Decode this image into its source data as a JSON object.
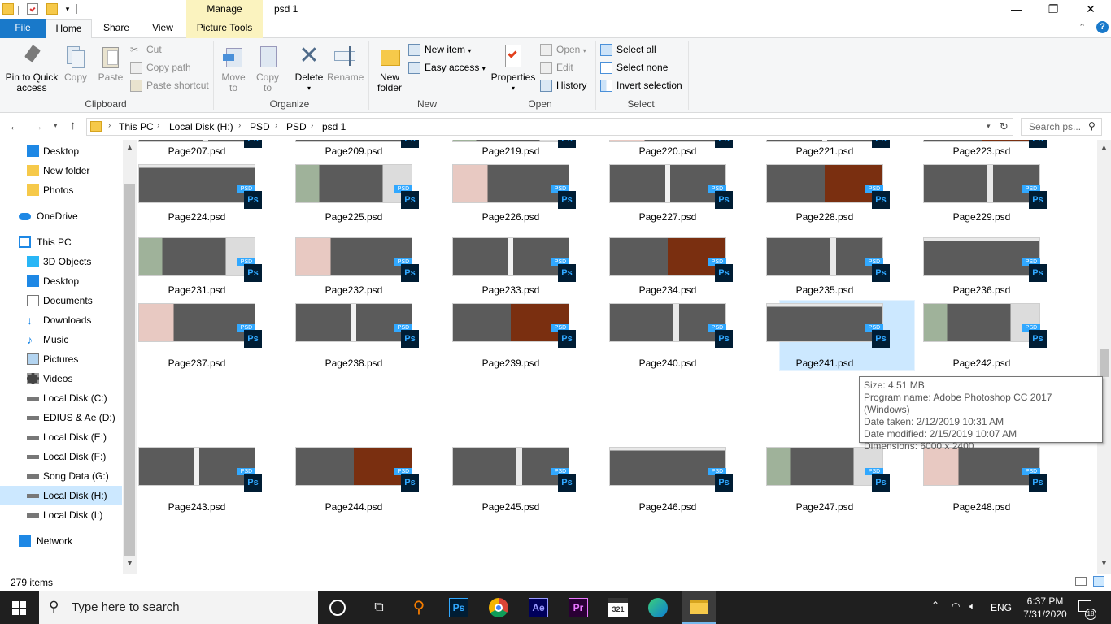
{
  "window": {
    "title": "psd 1",
    "contextual_tab": "Manage",
    "controls": {
      "minimize": "—",
      "restore": "❐",
      "close": "✕"
    }
  },
  "tabs": {
    "file": "File",
    "home": "Home",
    "share": "Share",
    "view": "View",
    "picture_tools": "Picture Tools"
  },
  "ribbon": {
    "clipboard": {
      "label": "Clipboard",
      "pin_line1": "Pin to Quick",
      "pin_line2": "access",
      "copy": "Copy",
      "paste": "Paste",
      "cut": "Cut",
      "copy_path": "Copy path",
      "paste_shortcut": "Paste shortcut"
    },
    "organize": {
      "label": "Organize",
      "move_line1": "Move",
      "move_line2": "to",
      "copy_line1": "Copy",
      "copy_line2": "to",
      "delete": "Delete",
      "rename": "Rename"
    },
    "new": {
      "label": "New",
      "folder_line1": "New",
      "folder_line2": "folder",
      "new_item": "New item",
      "easy_access": "Easy access"
    },
    "open": {
      "label": "Open",
      "properties": "Properties",
      "open": "Open",
      "edit": "Edit",
      "history": "History"
    },
    "select": {
      "label": "Select",
      "select_all": "Select all",
      "select_none": "Select none",
      "invert": "Invert selection"
    }
  },
  "address": {
    "crumbs": [
      "This PC",
      "Local Disk (H:)",
      "PSD",
      "PSD",
      "psd 1"
    ],
    "search_placeholder": "Search ps..."
  },
  "nav": [
    {
      "label": "Desktop",
      "icon": "desktop-icon"
    },
    {
      "label": "New folder",
      "icon": "folder-icon"
    },
    {
      "label": "Photos",
      "icon": "folder-icon"
    },
    {
      "label": "OneDrive",
      "icon": "cloud-icon"
    },
    {
      "label": "This PC",
      "icon": "pc-icon"
    },
    {
      "label": "3D Objects",
      "icon": "cube-icon"
    },
    {
      "label": "Desktop",
      "icon": "desktop-icon"
    },
    {
      "label": "Documents",
      "icon": "documents-icon"
    },
    {
      "label": "Downloads",
      "icon": "download-icon"
    },
    {
      "label": "Music",
      "icon": "music-icon"
    },
    {
      "label": "Pictures",
      "icon": "pictures-icon"
    },
    {
      "label": "Videos",
      "icon": "videos-icon"
    },
    {
      "label": "Local Disk (C:)",
      "icon": "drive-icon"
    },
    {
      "label": "EDIUS & Ae (D:)",
      "icon": "drive-icon"
    },
    {
      "label": "Local Disk (E:)",
      "icon": "drive-icon"
    },
    {
      "label": "Local Disk (F:)",
      "icon": "drive-icon"
    },
    {
      "label": "Song Data (G:)",
      "icon": "drive-icon"
    },
    {
      "label": "Local Disk (H:)",
      "icon": "drive-icon",
      "selected": true
    },
    {
      "label": "Local Disk (I:)",
      "icon": "drive-icon"
    },
    {
      "label": "Network",
      "icon": "network-icon"
    }
  ],
  "files": {
    "row0": [
      "Page207.psd",
      "Page209.psd",
      "Page219.psd",
      "Page220.psd",
      "Page221.psd",
      "Page223.psd"
    ],
    "row1": [
      "Page224.psd",
      "Page225.psd",
      "Page226.psd",
      "Page227.psd",
      "Page228.psd",
      "Page229.psd"
    ],
    "row2": [
      "Page231.psd",
      "Page232.psd",
      "Page233.psd",
      "Page234.psd",
      "Page235.psd",
      "Page236.psd"
    ],
    "row3": [
      "Page237.psd",
      "Page238.psd",
      "Page239.psd",
      "Page240.psd",
      "Page241.psd",
      "Page242.psd"
    ],
    "row4": [
      "Page243.psd",
      "Page244.psd",
      "Page245.psd",
      "Page246.psd",
      "Page247.psd",
      "Page248.psd"
    ],
    "badge_text": "Ps",
    "tag_text": "PSD",
    "selected": "Page241.psd"
  },
  "tooltip": {
    "size": "Size: 4.51 MB",
    "program": "Program name: Adobe Photoshop CC 2017 (Windows)",
    "taken": "Date taken: 2/12/2019 10:31 AM",
    "modified": "Date modified: 2/15/2019 10:07 AM",
    "dimensions": "Dimensions: 6000 x 2400"
  },
  "status": {
    "items": "279 items"
  },
  "taskbar": {
    "search_placeholder": "Type here to search",
    "time": "6:37 PM",
    "date": "7/31/2020",
    "lang": "ENG",
    "notifications": "18",
    "apps": [
      "cortana-icon",
      "task-view-icon",
      "search-app-icon",
      "photoshop-icon",
      "chrome-icon",
      "after-effects-icon",
      "premiere-icon",
      "calendar-app-icon",
      "edge-icon",
      "file-explorer-icon"
    ]
  },
  "colors": {
    "file_tab": "#1979ca",
    "manage": "#fbf3bf",
    "selection": "#cce8ff",
    "ps_badge": "#001d34",
    "ps_blue": "#31a8ff",
    "taskbar": "#1f1f1f"
  }
}
